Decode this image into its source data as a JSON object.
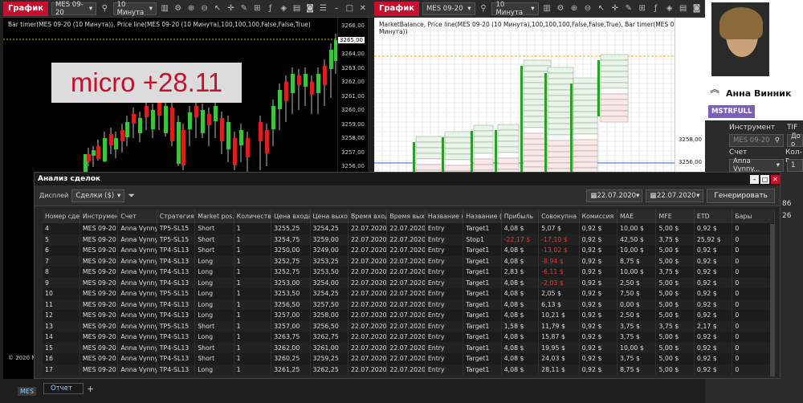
{
  "left_panel": {
    "tab": "График",
    "instrument": "MES 09-20",
    "interval": "10 Минута",
    "indicators": "Bar timer(MES 09-20 (10 Минута)), Price line(MES 09-20 (10 Минута),100,100,100,False,False,True)",
    "overlay": "micro +28.11",
    "y_ticks": [
      "3266,00",
      "3265,00",
      "3264,00",
      "3263,00",
      "3262,00",
      "3261,00",
      "3260,00",
      "3259,00",
      "3258,00",
      "3257,00",
      "3256,00"
    ],
    "footer": "© 2020 Ni",
    "bottom_tab": "MES"
  },
  "right_panel": {
    "tab": "График",
    "instrument": "MES 09-20",
    "interval": "10 Минута",
    "indicators": "MarketBalance, Price line(MES 09-20 (10 Минута),100,100,100,False,False,True), Bar timer(MES 09-20 (10 Минута))",
    "y_ticks": [
      "3258,00",
      "3256,00"
    ]
  },
  "profile": {
    "name": "Анна Винник",
    "badge": "MSTRFULL"
  },
  "side": {
    "instrument_label": "Инструмент",
    "tif_label": "TIF",
    "instrument_value": "MES 09-20",
    "tif_value": "До о",
    "account_label": "Счет",
    "qty_label": "Кол-в",
    "account_value": "Anna Vynny...",
    "qty_value": "1",
    "n1": "86",
    "n2": "26"
  },
  "dialog": {
    "title": "Анализ сделок",
    "display_label": "Дисплей",
    "display_value": "Сделки ($)",
    "date_from": "22.07.2020",
    "date_to": "22.07.2020",
    "generate": "Генерировать",
    "bottom_tab": "Отчет",
    "add": "+"
  },
  "columns": [
    "Номер сде",
    "Инструмен",
    "Счет",
    "Стратегия",
    "Market pos.",
    "Количество",
    "Цена входа",
    "Цена выхода",
    "Время входа",
    "Время вых",
    "Название (",
    "Название (",
    "Прибыль",
    "Совокупна",
    "Комиссия",
    "MAE",
    "MFE",
    "ETD",
    "Бары"
  ],
  "rows": [
    [
      "4",
      "MES 09-20",
      "Anna Vynny",
      "TP5-SL15",
      "Short",
      "1",
      "3255,25",
      "3254,25",
      "22.07.2020",
      "22.07.2020",
      "Entry",
      "Target1",
      "4,08 $",
      "5,07 $",
      "0,92 $",
      "10,00 $",
      "5,00 $",
      "0,92 $",
      "0"
    ],
    [
      "5",
      "MES 09-20",
      "Anna Vynny",
      "TP5-SL15",
      "Short",
      "1",
      "3254,75",
      "3259,00",
      "22.07.2020",
      "22.07.2020",
      "Entry",
      "Stop1",
      "-22,17 $",
      "-17,10 $",
      "0,92 $",
      "42,50 $",
      "3,75 $",
      "25,92 $",
      "0"
    ],
    [
      "6",
      "MES 09-20",
      "Anna Vynny",
      "TP4-SL13",
      "Short",
      "1",
      "3250,00",
      "3249,00",
      "22.07.2020",
      "22.07.2020",
      "Entry",
      "Target1",
      "4,08 $",
      "-13,02 $",
      "0,92 $",
      "10,00 $",
      "5,00 $",
      "0,92 $",
      "0"
    ],
    [
      "7",
      "MES 09-20",
      "Anna Vynny",
      "TP4-SL13",
      "Long",
      "1",
      "3252,75",
      "3253,25",
      "22.07.2020",
      "22.07.2020",
      "Entry",
      "Target1",
      "4,08 $",
      "-8,94 $",
      "0,92 $",
      "8,75 $",
      "5,00 $",
      "0,92 $",
      "0"
    ],
    [
      "8",
      "MES 09-20",
      "Anna Vynny",
      "TP4-SL13",
      "Long",
      "1",
      "3252,75",
      "3253,50",
      "22.07.2020",
      "22.07.2020",
      "Entry",
      "Target1",
      "2,83 $",
      "-6,11 $",
      "0,92 $",
      "10,00 $",
      "3,75 $",
      "0,92 $",
      "0"
    ],
    [
      "9",
      "MES 09-20",
      "Anna Vynny",
      "TP4-SL13",
      "Long",
      "1",
      "3253,00",
      "3254,00",
      "22.07.2020",
      "22.07.2020",
      "Entry",
      "Target1",
      "4,08 $",
      "-2,03 $",
      "0,92 $",
      "2,50 $",
      "5,00 $",
      "0,92 $",
      "0"
    ],
    [
      "10",
      "MES 09-20",
      "Anna Vynny",
      "TP5-SL15",
      "Long",
      "1",
      "3253,50",
      "3254,25",
      "22.07.2020",
      "22.07.2020",
      "Entry",
      "Target1",
      "4,08 $",
      "2,05 $",
      "0,92 $",
      "7,50 $",
      "5,00 $",
      "0,92 $",
      "0"
    ],
    [
      "11",
      "MES 09-20",
      "Anna Vynny",
      "TP4-SL13",
      "Long",
      "1",
      "3256,50",
      "3257,50",
      "22.07.2020",
      "22.07.2020",
      "Entry",
      "Target1",
      "4,08 $",
      "6,13 $",
      "0,92 $",
      "0,00 $",
      "5,00 $",
      "0,92 $",
      "0"
    ],
    [
      "12",
      "MES 09-20",
      "Anna Vynny",
      "TP4-SL13",
      "Long",
      "1",
      "3257,00",
      "3258,00",
      "22.07.2020",
      "22.07.2020",
      "Entry",
      "Target1",
      "4,08 $",
      "10,21 $",
      "0,92 $",
      "2,50 $",
      "5,00 $",
      "0,92 $",
      "0"
    ],
    [
      "13",
      "MES 09-20",
      "Anna Vynny",
      "TP5-SL15",
      "Short",
      "1",
      "3257,00",
      "3256,50",
      "22.07.2020",
      "22.07.2020",
      "Entry",
      "Target1",
      "1,58 $",
      "11,79 $",
      "0,92 $",
      "3,75 $",
      "3,75 $",
      "2,17 $",
      "0"
    ],
    [
      "14",
      "MES 09-20",
      "Anna Vynny",
      "TP4-SL13",
      "Long",
      "1",
      "3263,75",
      "3262,75",
      "22.07.2020",
      "22.07.2020",
      "Entry",
      "Target1",
      "4,08 $",
      "15,87 $",
      "0,92 $",
      "3,75 $",
      "5,00 $",
      "0,92 $",
      "0"
    ],
    [
      "15",
      "MES 09-20",
      "Anna Vynny",
      "TP4-SL13",
      "Short",
      "1",
      "3262,00",
      "3261,00",
      "22.07.2020",
      "22.07.2020",
      "Entry",
      "Target1",
      "4,08 $",
      "19,95 $",
      "0,92 $",
      "10,00 $",
      "5,00 $",
      "0,92 $",
      "0"
    ],
    [
      "16",
      "MES 09-20",
      "Anna Vynny",
      "TP4-SL13",
      "Short",
      "1",
      "3260,25",
      "3259,25",
      "22.07.2020",
      "22.07.2020",
      "Entry",
      "Target1",
      "4,08 $",
      "24,03 $",
      "0,92 $",
      "3,75 $",
      "5,00 $",
      "0,92 $",
      "0"
    ],
    [
      "17",
      "MES 09-20",
      "Anna Vynny",
      "TP4-SL13",
      "Long",
      "1",
      "3261,25",
      "3262,25",
      "22.07.2020",
      "22.07.2020",
      "Entry",
      "Target1",
      "4,08 $",
      "28,11 $",
      "0,92 $",
      "8,75 $",
      "5,00 $",
      "0,92 $",
      "0"
    ]
  ]
}
